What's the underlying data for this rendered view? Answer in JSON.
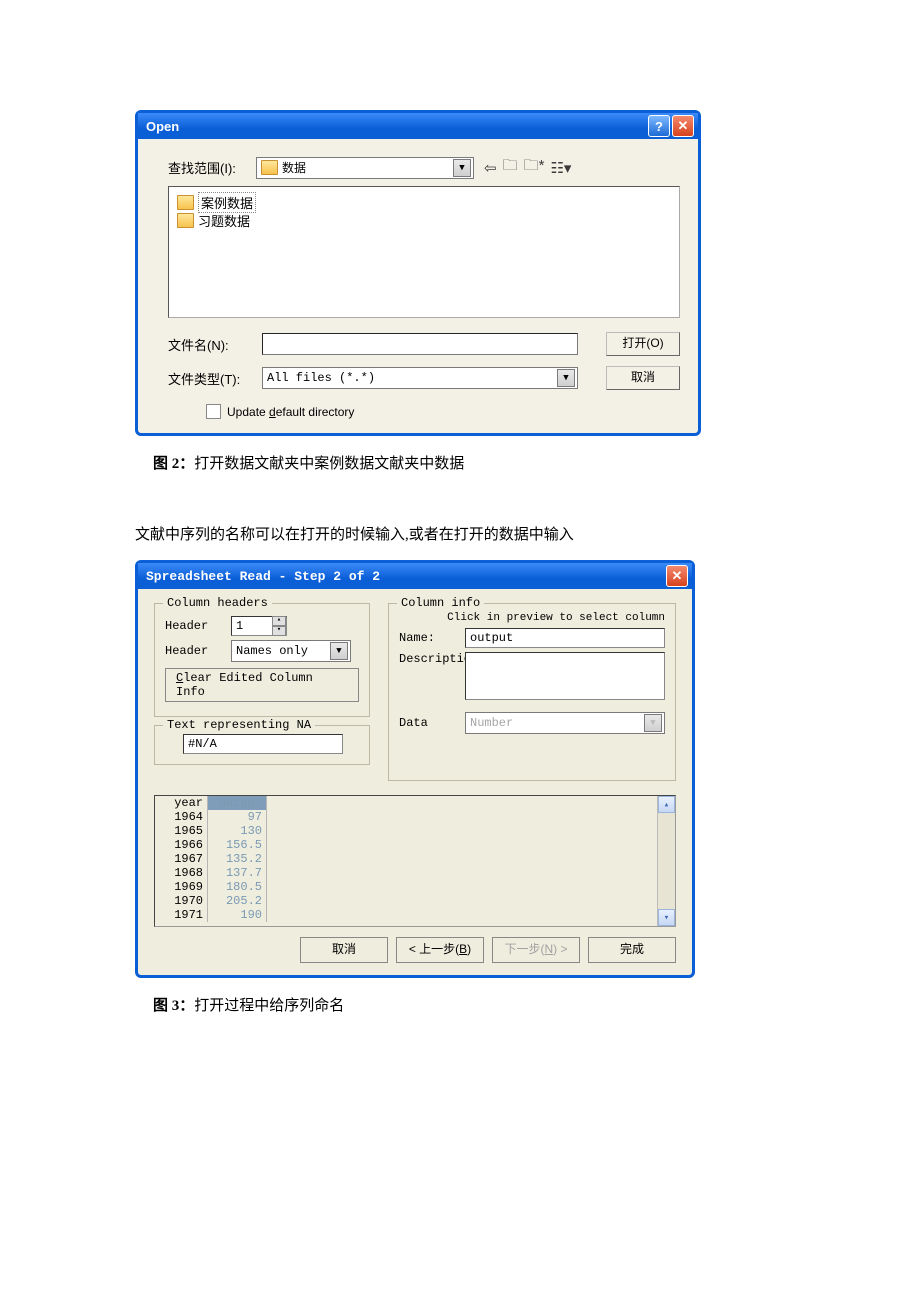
{
  "open_dialog": {
    "title": "Open",
    "look_in_label": "查找范围(I):",
    "look_in_value": "数据",
    "folders": [
      "案例数据",
      "习题数据"
    ],
    "filename_label": "文件名(N):",
    "filename_value": "",
    "filetype_label": "文件类型(T):",
    "filetype_value": "All files (*.*)",
    "open_btn": "打开(O)",
    "cancel_btn": "取消",
    "update_dir_label": "Update default directory"
  },
  "caption2_prefix": "图 2：",
  "caption2_text": "打开数据文献夹中案例数据文献夹中数据",
  "paragraph": "文献中序列的名称可以在打开的时候输入,或者在打开的数据中输入",
  "spread_dialog": {
    "title": "Spreadsheet Read - Step 2 of 2",
    "col_headers_legend": "Column headers",
    "header_label": "Header",
    "header_value": "1",
    "header_mode": "Names only",
    "clear_btn": "Clear Edited Column Info",
    "na_legend": "Text representing NA",
    "na_value": "#N/A",
    "col_info_legend": "Column info",
    "col_info_hint": "Click in preview to select column",
    "name_label": "Name:",
    "name_value": "output",
    "desc_label": "Descriptio",
    "data_label": "Data",
    "data_type": "Number",
    "preview_headers": [
      "year",
      "output"
    ],
    "preview_rows": [
      {
        "year": "1964",
        "output": "97"
      },
      {
        "year": "1965",
        "output": "130"
      },
      {
        "year": "1966",
        "output": "156.5"
      },
      {
        "year": "1967",
        "output": "135.2"
      },
      {
        "year": "1968",
        "output": "137.7"
      },
      {
        "year": "1969",
        "output": "180.5"
      },
      {
        "year": "1970",
        "output": "205.2"
      },
      {
        "year": "1971",
        "output": "190"
      }
    ],
    "cancel_btn": "取消",
    "back_btn": "< 上一步(B)",
    "next_btn": "下一步(N) >",
    "finish_btn": "完成"
  },
  "caption3_prefix": "图 3：",
  "caption3_text": "打开过程中给序列命名"
}
